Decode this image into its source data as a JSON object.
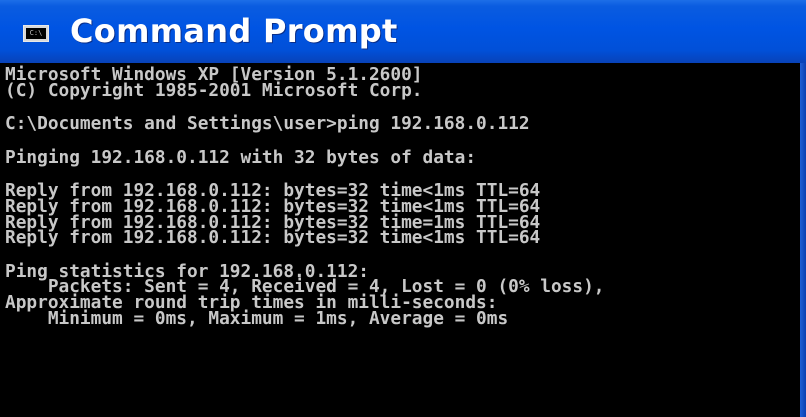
{
  "window": {
    "title": "Command Prompt",
    "icon": "cmd-console-icon",
    "icon_glyph": "C:\\"
  },
  "console": {
    "lines": [
      "Microsoft Windows XP [Version 5.1.2600]",
      "(C) Copyright 1985-2001 Microsoft Corp.",
      "",
      "C:\\Documents and Settings\\user>ping 192.168.0.112",
      "",
      "Pinging 192.168.0.112 with 32 bytes of data:",
      "",
      "Reply from 192.168.0.112: bytes=32 time<1ms TTL=64",
      "Reply from 192.168.0.112: bytes=32 time<1ms TTL=64",
      "Reply from 192.168.0.112: bytes=32 time=1ms TTL=64",
      "Reply from 192.168.0.112: bytes=32 time<1ms TTL=64",
      "",
      "Ping statistics for 192.168.0.112:",
      "    Packets: Sent = 4, Received = 4, Lost = 0 (0% loss),",
      "Approximate round trip times in milli-seconds:",
      "    Minimum = 0ms, Maximum = 1ms, Average = 0ms"
    ]
  },
  "colors": {
    "titlebar": "#0054e3",
    "console_bg": "#000000",
    "console_text": "#c8c8c8"
  }
}
